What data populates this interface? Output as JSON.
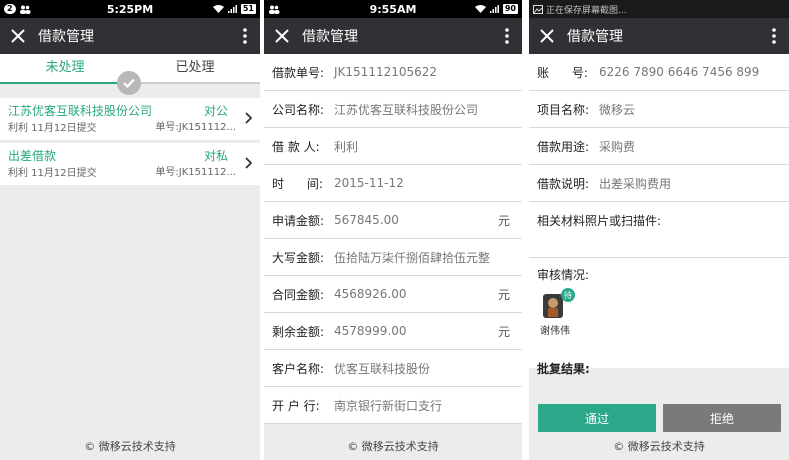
{
  "panel1": {
    "status": {
      "time": "5:25PM",
      "notif_count": "2",
      "battery": "51"
    },
    "title": "借款管理",
    "tabs": [
      {
        "label": "未处理"
      },
      {
        "label": "已处理"
      }
    ],
    "items": [
      {
        "title": "江苏优客互联科技股份公司",
        "tag": "对公",
        "sub": "利利 11月12日提交",
        "order": "单号:JK151112..."
      },
      {
        "title": "出差借款",
        "tag": "对私",
        "sub": "利利 11月12日提交",
        "order": "单号:JK151112..."
      }
    ],
    "footer": "© 微移云技术支持"
  },
  "panel2": {
    "status": {
      "time": "9:55AM",
      "battery": "90"
    },
    "title": "借款管理",
    "rows": [
      {
        "label": "借款单号:",
        "value": "JK151112105622",
        "unit": ""
      },
      {
        "label": "公司名称:",
        "value": "江苏优客互联科技股份公司",
        "unit": ""
      },
      {
        "label": "借 款 人:",
        "value": "利利",
        "unit": ""
      },
      {
        "label": "时      间:",
        "value": "2015-11-12",
        "unit": ""
      },
      {
        "label": "申请金额:",
        "value": "567845.00",
        "unit": "元"
      },
      {
        "label": "大写金额:",
        "value": "伍拾陆万柒仟捌佰肆拾伍元整",
        "unit": ""
      },
      {
        "label": "合同金额:",
        "value": "4568926.00",
        "unit": "元"
      },
      {
        "label": "剩余金额:",
        "value": "4578999.00",
        "unit": "元"
      },
      {
        "label": "客户名称:",
        "value": "优客互联科技股份",
        "unit": ""
      },
      {
        "label": "开 户 行:",
        "value": "南京银行新街口支行",
        "unit": ""
      }
    ],
    "footer": "© 微移云技术支持"
  },
  "panel3": {
    "status": {
      "text": "正在保存屏幕截图..."
    },
    "title": "借款管理",
    "rows": [
      {
        "label": "账      号:",
        "value": "6226 7890 6646 7456 899"
      },
      {
        "label": "项目名称:",
        "value": "微移云"
      },
      {
        "label": "借款用途:",
        "value": "采购费"
      },
      {
        "label": "借款说明:",
        "value": "出差采购费用"
      }
    ],
    "attachments_label": "相关材料照片或扫描件:",
    "review_label": "审核情况:",
    "reviewer": {
      "name": "谢伟伟",
      "badge": "待"
    },
    "approval_label": "批复结果:",
    "approve_label": "通过",
    "reject_label": "拒绝",
    "footer": "© 微移云技术支持"
  },
  "colors": {
    "accent": "#27a880",
    "titlebar": "#2f3134",
    "reject": "#7a7a7a"
  }
}
